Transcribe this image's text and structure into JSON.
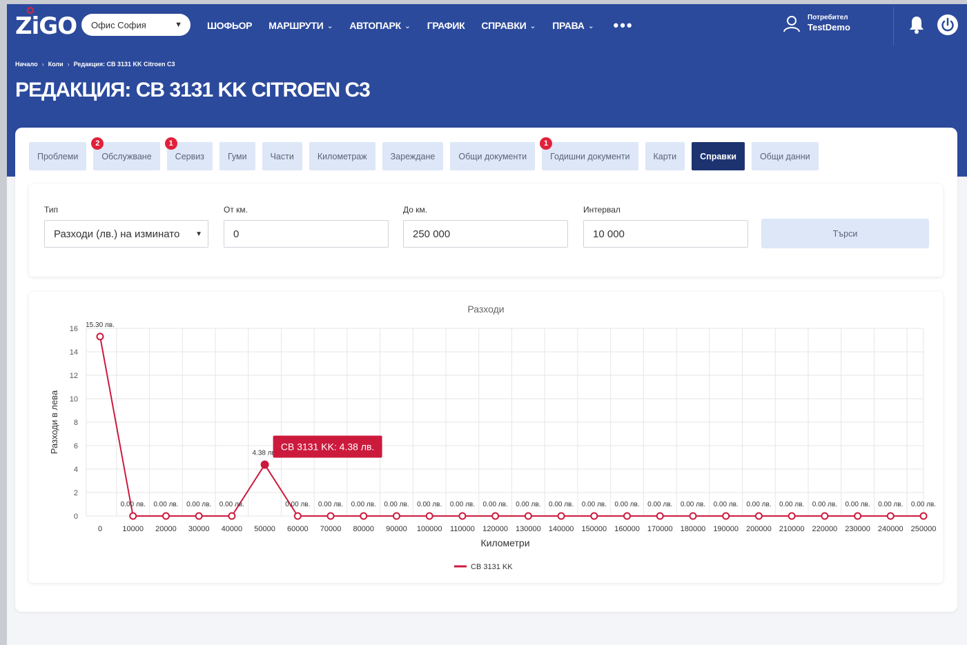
{
  "app": {
    "logo": "ZiGO",
    "office_select": "Офис София",
    "nav": [
      {
        "label": "ШОФЬОР",
        "has_dropdown": false
      },
      {
        "label": "МАРШРУТИ",
        "has_dropdown": true
      },
      {
        "label": "АВТОПАРК",
        "has_dropdown": true
      },
      {
        "label": "ГРАФИК",
        "has_dropdown": false
      },
      {
        "label": "СПРАВКИ",
        "has_dropdown": true
      },
      {
        "label": "ПРАВА",
        "has_dropdown": true
      }
    ],
    "more": "•••",
    "user_label": "Потребител",
    "user_name": "TestDemo"
  },
  "breadcrumb": [
    "Начало",
    "Коли",
    "Редакция: CB 3131 KK Citroen C3"
  ],
  "page_title": "РЕДАКЦИЯ: CB 3131 KK CITROEN C3",
  "tabs": [
    {
      "label": "Проблеми",
      "badge": null,
      "active": false
    },
    {
      "label": "Обслужване",
      "badge": "2",
      "active": false
    },
    {
      "label": "Сервиз",
      "badge": "1",
      "active": false
    },
    {
      "label": "Гуми",
      "badge": null,
      "active": false
    },
    {
      "label": "Части",
      "badge": null,
      "active": false
    },
    {
      "label": "Километраж",
      "badge": null,
      "active": false
    },
    {
      "label": "Зареждане",
      "badge": null,
      "active": false
    },
    {
      "label": "Общи документи",
      "badge": null,
      "active": false
    },
    {
      "label": "Годишни документи",
      "badge": "1",
      "active": false
    },
    {
      "label": "Карти",
      "badge": null,
      "active": false
    },
    {
      "label": "Справки",
      "badge": null,
      "active": true
    },
    {
      "label": "Общи данни",
      "badge": null,
      "active": false
    }
  ],
  "filters": {
    "type_label": "Тип",
    "type_value": "Разходи (лв.) на изминато",
    "from_label": "От км.",
    "from_value": "0",
    "to_label": "До км.",
    "to_value": "250 000",
    "interval_label": "Интервал",
    "interval_value": "10 000",
    "search_label": "Търси"
  },
  "colors": {
    "header": "#2c4a9c",
    "active_tab": "#1c3370",
    "tab_bg": "#dde7f7",
    "badge": "#e1213b",
    "series": "#cc1a3d"
  },
  "chart_data": {
    "type": "line",
    "title": "Разходи",
    "xlabel": "Километри",
    "ylabel": "Разходи в лева",
    "ylim": [
      0,
      16
    ],
    "yticks": [
      0,
      2,
      4,
      6,
      8,
      10,
      12,
      14,
      16
    ],
    "x": [
      0,
      10000,
      20000,
      30000,
      40000,
      50000,
      60000,
      70000,
      80000,
      90000,
      100000,
      110000,
      120000,
      130000,
      140000,
      150000,
      160000,
      170000,
      180000,
      190000,
      200000,
      210000,
      220000,
      230000,
      240000,
      250000
    ],
    "series": [
      {
        "name": "CB 3131 KK",
        "values": [
          15.3,
          0,
          0,
          0,
          0,
          4.38,
          0,
          0,
          0,
          0,
          0,
          0,
          0,
          0,
          0,
          0,
          0,
          0,
          0,
          0,
          0,
          0,
          0,
          0,
          0,
          0
        ],
        "labels": [
          "15.30 лв.",
          "0.00 лв.",
          "0.00 лв.",
          "0.00 лв.",
          "0.00 лв.",
          "4.38 лв.",
          "0.00 лв.",
          "0.00 лв.",
          "0.00 лв.",
          "0.00 лв.",
          "0.00 лв.",
          "0.00 лв.",
          "0.00 лв.",
          "0.00 лв.",
          "0.00 лв.",
          "0.00 лв.",
          "0.00 лв.",
          "0.00 лв.",
          "0.00 лв.",
          "0.00 лв.",
          "0.00 лв.",
          "0.00 лв.",
          "0.00 лв.",
          "0.00 лв.",
          "0.00 лв.",
          "0.00 лв."
        ]
      }
    ],
    "grid": true,
    "legend": "bottom-center",
    "tooltip": "CB 3131 KK: 4.38 лв."
  }
}
